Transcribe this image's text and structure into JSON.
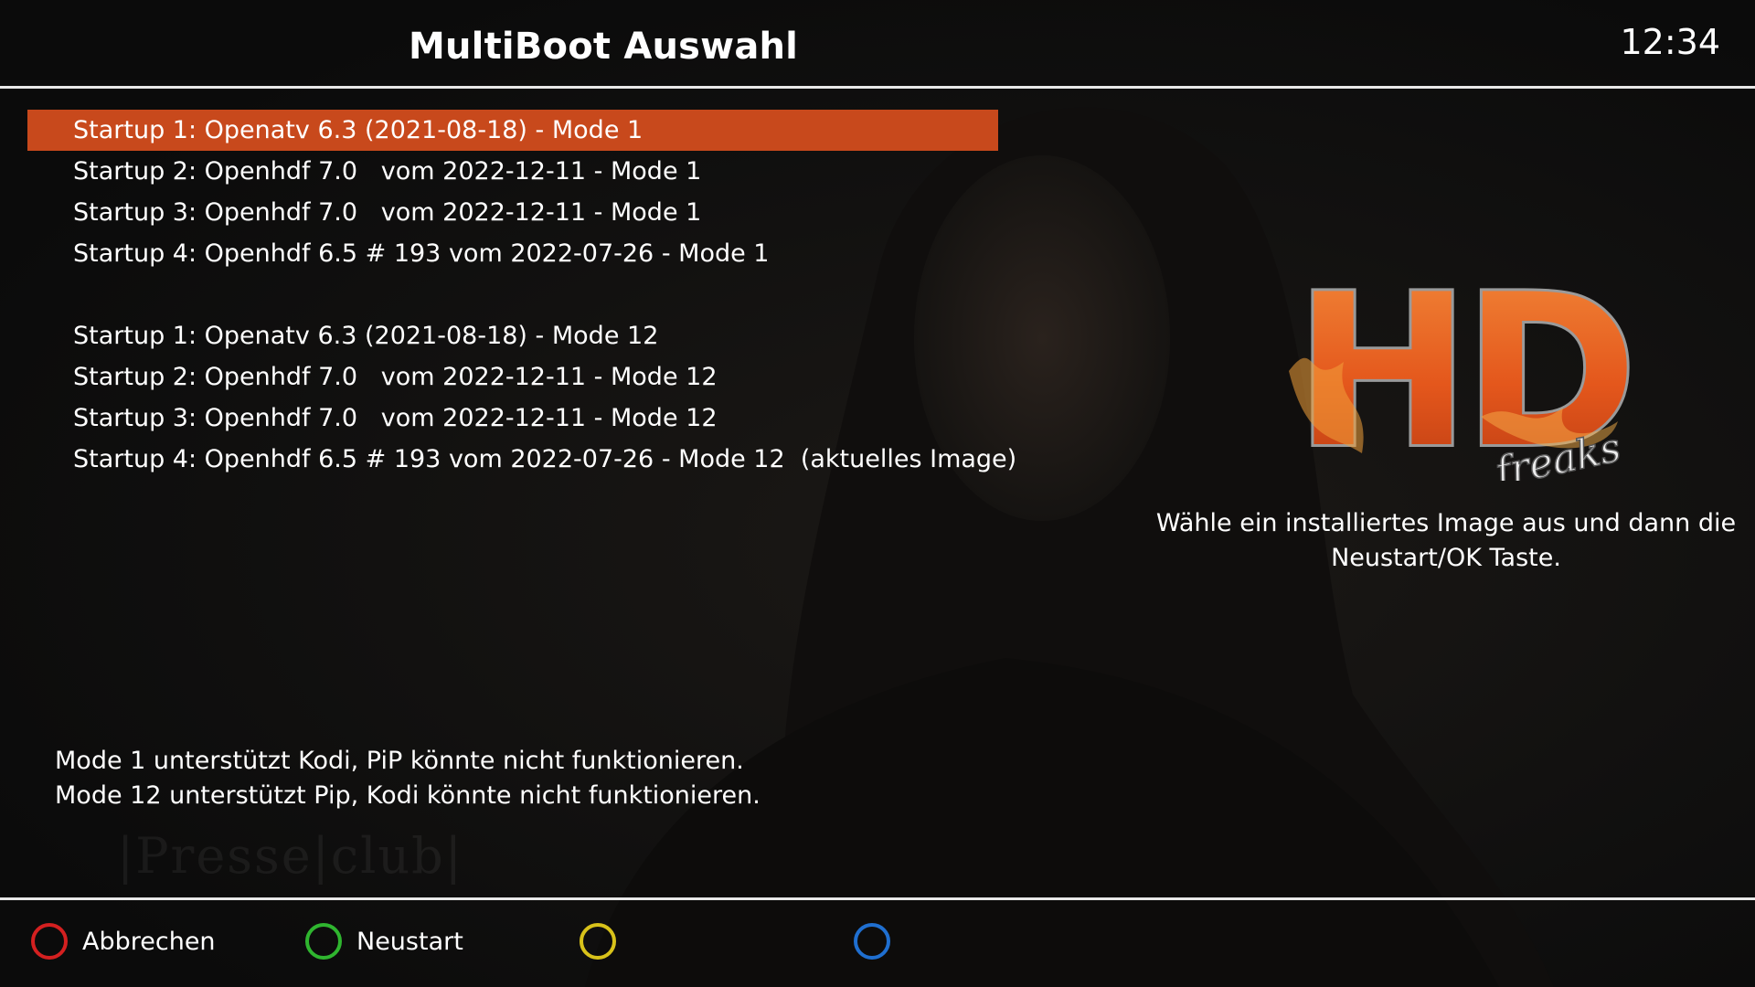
{
  "header": {
    "title": "MultiBoot Auswahl",
    "clock": "12:34"
  },
  "boot_list": {
    "selected_index": 0,
    "items": [
      "Startup 1: Openatv 6.3 (2021-08-18) - Mode 1",
      "Startup 2: Openhdf 7.0   vom 2022-12-11 - Mode 1",
      "Startup 3: Openhdf 7.0   vom 2022-12-11 - Mode 1",
      "Startup 4: Openhdf 6.5 # 193 vom 2022-07-26 - Mode 1",
      "",
      "Startup 1: Openatv 6.3 (2021-08-18) - Mode 12",
      "Startup 2: Openhdf 7.0   vom 2022-12-11 - Mode 12",
      "Startup 3: Openhdf 7.0   vom 2022-12-11 - Mode 12",
      "Startup 4: Openhdf 6.5 # 193 vom 2022-07-26 - Mode 12  (aktuelles Image)"
    ]
  },
  "logo": {
    "main_text": "HD",
    "sub_text": "freaks"
  },
  "hint": "Wähle ein installiertes Image aus und dann die Neustart/OK Taste.",
  "mode_info": {
    "line1": "Mode 1 unterstützt Kodi, PiP könnte nicht funktionieren.",
    "line2": "Mode 12 unterstützt Pip, Kodi könnte nicht funktionieren."
  },
  "background": {
    "watermark_text": "|Presse|club|"
  },
  "buttons": {
    "red": {
      "label": "Abbrechen",
      "color": "#d42020"
    },
    "green": {
      "label": "Neustart",
      "color": "#2fb52f"
    },
    "yellow": {
      "label": "",
      "color": "#d8c21a"
    },
    "blue": {
      "label": "",
      "color": "#1f6fd0"
    }
  },
  "colors": {
    "selection": "#c8491c",
    "rule": "#e8e8e8"
  }
}
